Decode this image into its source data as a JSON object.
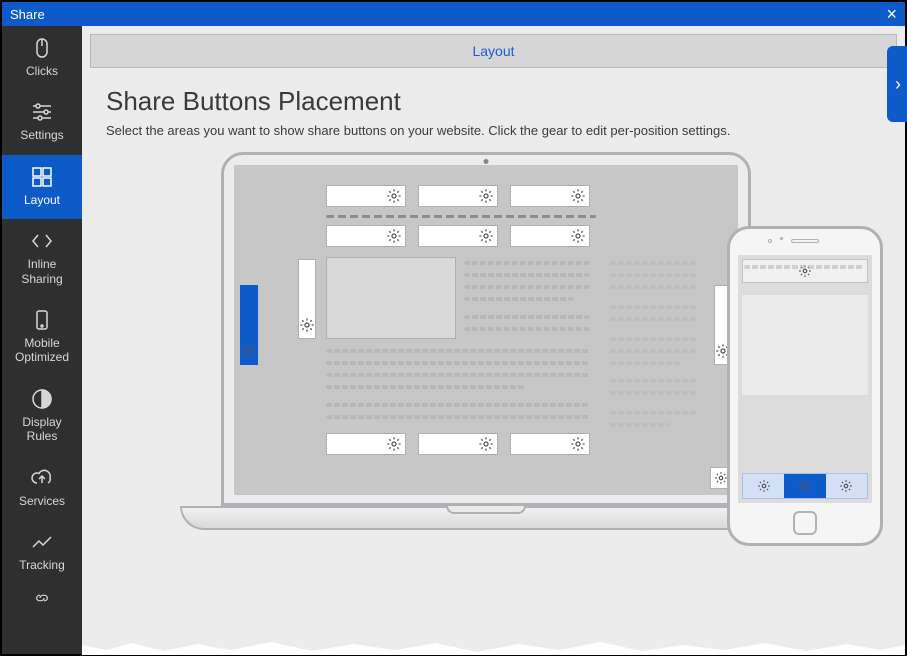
{
  "window": {
    "title": "Share"
  },
  "sidebar": {
    "items": [
      {
        "label": "Clicks"
      },
      {
        "label": "Settings"
      },
      {
        "label": "Layout"
      },
      {
        "label": "Inline Sharing"
      },
      {
        "label": "Mobile Optimized"
      },
      {
        "label": "Display Rules"
      },
      {
        "label": "Services"
      },
      {
        "label": "Tracking"
      }
    ],
    "active_index": 2
  },
  "tab": {
    "label": "Layout"
  },
  "page": {
    "heading": "Share Buttons Placement",
    "subheading": "Select the areas you want to show share buttons on your website. Click the gear to edit per-position settings."
  },
  "laptop_slots": {
    "top_row1": [
      "top-left",
      "top-center",
      "top-right"
    ],
    "top_row2": [
      "header-left",
      "header-center",
      "header-right"
    ],
    "left_side": "left",
    "right_side": "right",
    "content_side": "content-side",
    "bottom_row": [
      "bottom-left",
      "bottom-center",
      "bottom-right"
    ],
    "corner": "bottom-right-corner",
    "selected": "left"
  },
  "phone_slots": {
    "top": "mobile-top",
    "bottom": [
      "mobile-bottom-left",
      "mobile-bottom-center",
      "mobile-bottom-right"
    ],
    "selected": "mobile-bottom-center"
  }
}
